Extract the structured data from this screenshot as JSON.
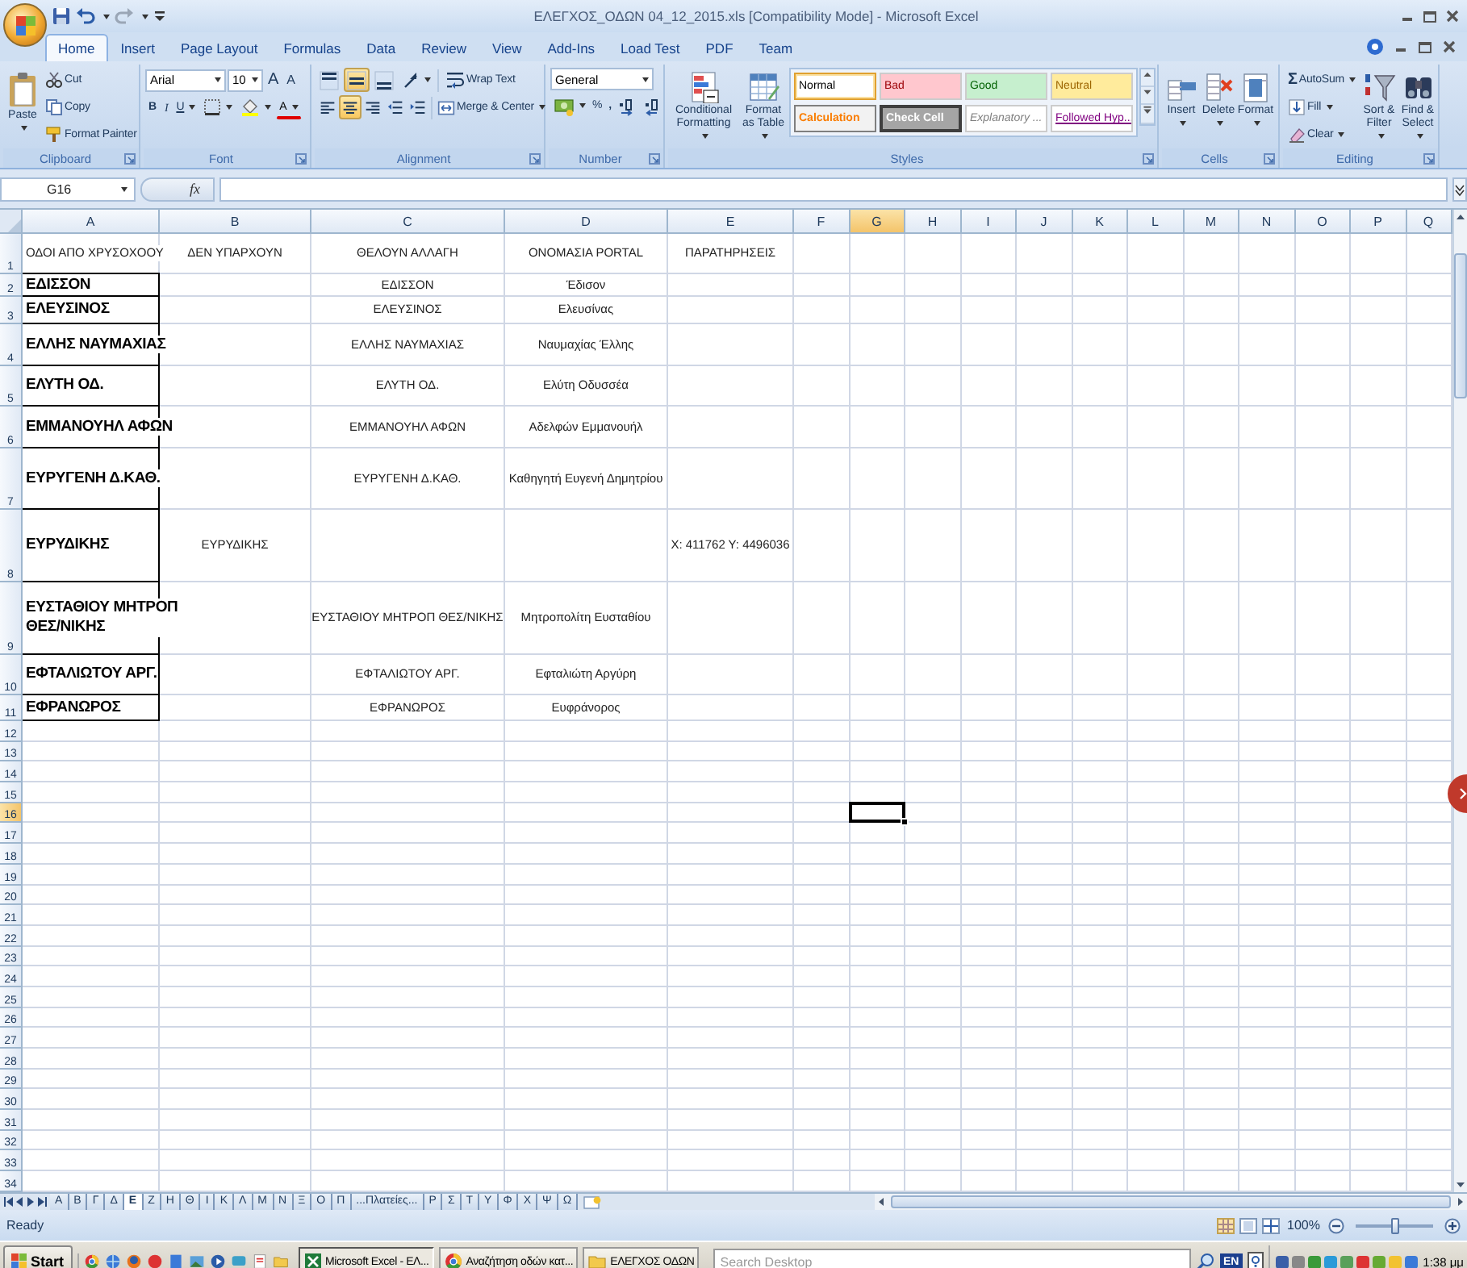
{
  "window": {
    "title": "ΕΛΕΓΧΟΣ_ΟΔΩΝ 04_12_2015.xls  [Compatibility Mode] - Microsoft Excel"
  },
  "ribbon_tabs": [
    {
      "label": "Home",
      "selected": true
    },
    {
      "label": "Insert",
      "selected": false
    },
    {
      "label": "Page Layout",
      "selected": false
    },
    {
      "label": "Formulas",
      "selected": false
    },
    {
      "label": "Data",
      "selected": false
    },
    {
      "label": "Review",
      "selected": false
    },
    {
      "label": "View",
      "selected": false
    },
    {
      "label": "Add-Ins",
      "selected": false
    },
    {
      "label": "Load Test",
      "selected": false
    },
    {
      "label": "PDF",
      "selected": false
    },
    {
      "label": "Team",
      "selected": false
    }
  ],
  "clipboard": {
    "label": "Clipboard",
    "paste": "Paste",
    "cut": "Cut",
    "copy": "Copy",
    "format_painter": "Format Painter"
  },
  "font": {
    "label": "Font",
    "name": "Arial",
    "size": "10",
    "grow": "A",
    "shrink": "A",
    "bold": "B",
    "italic": "I",
    "underline": "U",
    "font_color": "A"
  },
  "alignment": {
    "label": "Alignment",
    "vertical_align": [
      {
        "selected": false
      },
      {
        "selected": true
      },
      {
        "selected": false
      }
    ],
    "wrap_text": "Wrap Text",
    "horizontal_align": [
      {
        "selected": false
      },
      {
        "selected": true
      },
      {
        "selected": false
      }
    ],
    "merge": "Merge & Center"
  },
  "number": {
    "label": "Number",
    "format": "General",
    "percent": "%",
    "comma": ","
  },
  "styles": {
    "label": "Styles",
    "conditional_formatting": "Conditional Formatting",
    "format_as_table": "Format as Table",
    "cell_styles": [
      {
        "label": "Normal",
        "kind": "normal",
        "selected": true
      },
      {
        "label": "Bad",
        "kind": "bad",
        "selected": false
      },
      {
        "label": "Good",
        "kind": "good",
        "selected": false
      },
      {
        "label": "Neutral",
        "kind": "neutral",
        "selected": false
      },
      {
        "label": "Calculation",
        "kind": "calculation",
        "selected": false
      },
      {
        "label": "Check Cell",
        "kind": "check",
        "selected": false
      },
      {
        "label": "Explanatory ...",
        "kind": "explanatory",
        "selected": false
      },
      {
        "label": "Followed Hyp...",
        "kind": "hyperlink",
        "selected": false
      }
    ]
  },
  "cells": {
    "label": "Cells",
    "buttons": [
      "Insert",
      "Delete",
      "Format"
    ]
  },
  "editing": {
    "label": "Editing",
    "autosum_icon": "Σ",
    "autosum": "AutoSum",
    "fill": "Fill",
    "clear": "Clear",
    "sort_filter": "Sort & Filter",
    "find_select": "Find & Select"
  },
  "formula_bar": {
    "name_box": "G16",
    "fx": "fx"
  },
  "sheet": {
    "columns": [
      {
        "label": "A",
        "selected": false
      },
      {
        "label": "B",
        "selected": false
      },
      {
        "label": "C",
        "selected": false
      },
      {
        "label": "D",
        "selected": false
      },
      {
        "label": "E",
        "selected": false
      },
      {
        "label": "F",
        "selected": false
      },
      {
        "label": "G",
        "selected": true
      },
      {
        "label": "H",
        "selected": false
      },
      {
        "label": "I",
        "selected": false
      },
      {
        "label": "J",
        "selected": false
      },
      {
        "label": "K",
        "selected": false
      },
      {
        "label": "L",
        "selected": false
      },
      {
        "label": "M",
        "selected": false
      },
      {
        "label": "N",
        "selected": false
      },
      {
        "label": "O",
        "selected": false
      },
      {
        "label": "P",
        "selected": false
      },
      {
        "label": "Q",
        "selected": false
      }
    ],
    "rows": [
      {
        "number": "1",
        "selected": false,
        "a": "ΟΔΟΙ ΑΠΟ ΧΡΥΣΟΧΟΟΥ",
        "b": "ΔΕΝ ΥΠΑΡΧΟΥΝ",
        "c": "ΘΕΛΟΥΝ ΑΛΛΑΓΗ",
        "d": "ΟΝΟΜΑΣΙΑ PORTAL",
        "e": "ΠΑΡΑΤΗΡΗΣΕΙΣ"
      },
      {
        "number": "2",
        "selected": false,
        "a": "ΕΔΙΣΣΟΝ",
        "c": "ΕΔΙΣΣΟΝ",
        "d": "Έδισον"
      },
      {
        "number": "3",
        "selected": false,
        "a": "ΕΛΕΥΣΙΝΟΣ",
        "c": "ΕΛΕΥΣΙΝΟΣ",
        "d": "Ελευσίνας"
      },
      {
        "number": "4",
        "selected": false,
        "a": "ΕΛΛΗΣ ΝΑΥΜΑΧΙΑΣ",
        "c": "ΕΛΛΗΣ ΝΑΥΜΑΧΙΑΣ",
        "d": "Ναυμαχίας Έλλης"
      },
      {
        "number": "5",
        "selected": false,
        "a": "ΕΛΥΤΗ ΟΔ.",
        "c": "ΕΛΥΤΗ ΟΔ.",
        "d": "Ελύτη Οδυσσέα"
      },
      {
        "number": "6",
        "selected": false,
        "a": "ΕΜΜΑΝΟΥΗΛ ΑΦΩΝ",
        "c": "ΕΜΜΑΝΟΥΗΛ ΑΦΩΝ",
        "d": "Αδελφών Εμμανουήλ"
      },
      {
        "number": "7",
        "selected": false,
        "a": "ΕΥΡΥΓΕΝΗ Δ.ΚΑΘ.",
        "c": "ΕΥΡΥΓΕΝΗ Δ.ΚΑΘ.",
        "d": "Καθηγητή Ευγενή Δημητρίου"
      },
      {
        "number": "8",
        "selected": false,
        "a": "ΕΥΡΥΔΙΚΗΣ",
        "b": "ΕΥΡΥΔΙΚΗΣ",
        "e": "X: 411762 Y: 4496036"
      },
      {
        "number": "9",
        "selected": false,
        "a": "ΕΥΣΤΑΘΙΟΥ ΜΗΤΡΟΠ ΘΕΣ/ΝΙΚΗΣ",
        "c": "ΕΥΣΤΑΘΙΟΥ ΜΗΤΡΟΠ ΘΕΣ/ΝΙΚΗΣ",
        "d": "Μητροπολίτη Ευσταθίου"
      },
      {
        "number": "10",
        "selected": false,
        "a": "ΕΦΤΑΛΙΩΤΟΥ ΑΡΓ.",
        "c": "ΕΦΤΑΛΙΩΤΟΥ ΑΡΓ.",
        "d": "Εφταλιώτη Αργύρη"
      },
      {
        "number": "11",
        "selected": false,
        "a": "ΕΦΡΑΝΩΡΟΣ",
        "c": "ΕΦΡΑΝΩΡΟΣ",
        "d": "Ευφράνορος"
      },
      {
        "number": "12",
        "selected": false
      },
      {
        "number": "13",
        "selected": false
      },
      {
        "number": "14",
        "selected": false
      },
      {
        "number": "15",
        "selected": false
      },
      {
        "number": "16",
        "selected": true
      },
      {
        "number": "17",
        "selected": false
      },
      {
        "number": "18",
        "selected": false
      },
      {
        "number": "19",
        "selected": false
      },
      {
        "number": "20",
        "selected": false
      },
      {
        "number": "21",
        "selected": false
      },
      {
        "number": "22",
        "selected": false
      },
      {
        "number": "23",
        "selected": false
      },
      {
        "number": "24",
        "selected": false
      },
      {
        "number": "25",
        "selected": false
      },
      {
        "number": "26",
        "selected": false
      },
      {
        "number": "27",
        "selected": false
      },
      {
        "number": "28",
        "selected": false
      },
      {
        "number": "29",
        "selected": false
      },
      {
        "number": "30",
        "selected": false
      },
      {
        "number": "31",
        "selected": false
      },
      {
        "number": "32",
        "selected": false
      },
      {
        "number": "33",
        "selected": false
      },
      {
        "number": "34",
        "selected": false
      }
    ]
  },
  "sheet_tabs": [
    {
      "label": "Α",
      "selected": false
    },
    {
      "label": "Β",
      "selected": false
    },
    {
      "label": "Γ",
      "selected": false
    },
    {
      "label": "Δ",
      "selected": false
    },
    {
      "label": "Ε",
      "selected": true
    },
    {
      "label": "Ζ",
      "selected": false
    },
    {
      "label": "Η",
      "selected": false
    },
    {
      "label": "Θ",
      "selected": false
    },
    {
      "label": "Ι",
      "selected": false
    },
    {
      "label": "Κ",
      "selected": false
    },
    {
      "label": "Λ",
      "selected": false
    },
    {
      "label": "Μ",
      "selected": false
    },
    {
      "label": "Ν",
      "selected": false
    },
    {
      "label": "Ξ",
      "selected": false
    },
    {
      "label": "Ο",
      "selected": false
    },
    {
      "label": "Π",
      "selected": false
    },
    {
      "label": "...Πλατείες...",
      "selected": false
    },
    {
      "label": "Ρ",
      "selected": false
    },
    {
      "label": "Σ",
      "selected": false
    },
    {
      "label": "Τ",
      "selected": false
    },
    {
      "label": "Υ",
      "selected": false
    },
    {
      "label": "Φ",
      "selected": false
    },
    {
      "label": "Χ",
      "selected": false
    },
    {
      "label": "Ψ",
      "selected": false
    },
    {
      "label": "Ω",
      "selected": false
    }
  ],
  "status_bar": {
    "text": "Ready",
    "zoom": "100%",
    "zoom_slider": {
      "level": 0.5
    }
  },
  "taskbar": {
    "start": "Start",
    "tasks": [
      {
        "label": "Microsoft Excel - ΕΛ...",
        "kind": "excel",
        "selected": true
      },
      {
        "label": "Αναζήτηση οδών κατ...",
        "kind": "browser",
        "selected": false
      },
      {
        "label": "ΕΛΕΓΧΟΣ ΟΔΩΝ",
        "kind": "folder",
        "selected": false
      }
    ],
    "search": {
      "placeholder": "Search Desktop"
    },
    "language": "EN",
    "clock": "1:38 μμ"
  }
}
